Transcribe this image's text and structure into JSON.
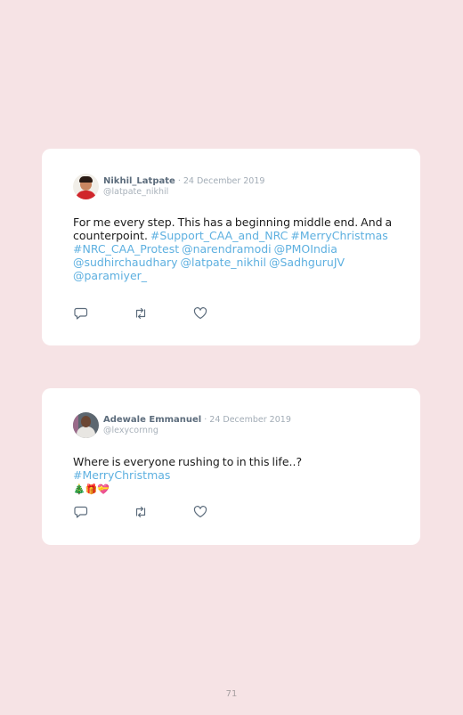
{
  "tweets": [
    {
      "name": "Nikhil_Latpate",
      "date": " · 24 December 2019",
      "handle": "@latpate_nikhil",
      "text_plain": "For me every step. This has a beginning middle end. And a counterpoint. ",
      "hashtags_line": "#Support_CAA_and_NRC #MerryChristmas #NRC_CAA_Protest @narendramodi @PMOIndia @sudhirchaudhary @latpate_nikhil @SadhguruJV @paramiyer_"
    },
    {
      "name": "Adewale Emmanuel",
      "date": " · 24 December 2019",
      "handle": "@lexycornng",
      "text_plain": "Where is everyone rushing to in this life..? ",
      "hashtags_line": "#MerryChristmas",
      "emoji": "🎄🎁💝"
    }
  ],
  "icons": [
    "reply-icon",
    "retweet-icon",
    "like-icon"
  ],
  "colors": {
    "background": "#f6e3e5",
    "link": "#5eb0e0",
    "name": "#5c6c7c"
  },
  "page_number": "71"
}
